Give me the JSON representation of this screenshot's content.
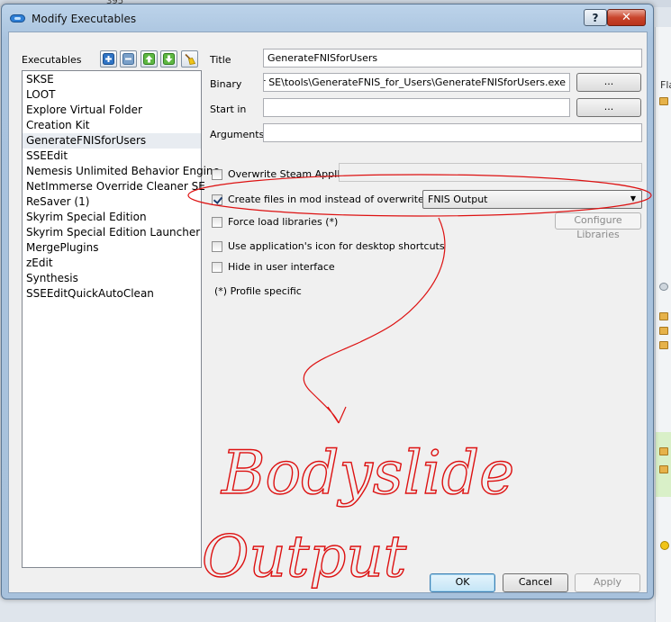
{
  "background": {
    "corner_number": "395",
    "right_label": "Fla"
  },
  "window": {
    "title": "Modify Executables",
    "help_glyph": "?",
    "close_glyph": "✕"
  },
  "executables": {
    "label": "Executables",
    "items": [
      "SKSE",
      "LOOT",
      "Explore Virtual Folder",
      "Creation Kit",
      "GenerateFNISforUsers",
      "SSEEdit",
      "Nemesis Unlimited Behavior Engine",
      "NetImmerse Override Cleaner SE",
      "ReSaver (1)",
      "Skyrim Special Edition",
      "Skyrim Special Edition Launcher",
      "MergePlugins",
      "zEdit",
      "Synthesis",
      "SSEEditQuickAutoClean"
    ],
    "selected": "GenerateFNISforUsers"
  },
  "form": {
    "title_label": "Title",
    "title_value": "GenerateFNISforUsers",
    "binary_label": "Binary",
    "binary_value": "ehavior SE\\tools\\GenerateFNIS_for_Users\\GenerateFNISforUsers.exe",
    "start_in_label": "Start in",
    "start_in_value": "",
    "arguments_label": "Arguments",
    "arguments_value": "",
    "browse_label": "...",
    "overwrite_steam_appid": {
      "label": "Overwrite Steam AppID",
      "checked": false,
      "value": ""
    },
    "create_files_in_mod": {
      "label": "Create files in mod instead of overwrite (*)",
      "checked": true
    },
    "mod_combo_value": "FNIS Output",
    "force_load_libraries": {
      "label": "Force load libraries (*)",
      "checked": false
    },
    "configure_libraries_label": "Configure Libraries",
    "use_app_icon": {
      "label": "Use application's icon for desktop shortcuts",
      "checked": false
    },
    "hide_in_ui": {
      "label": "Hide in user interface",
      "checked": false
    },
    "profile_note": "(*) Profile specific"
  },
  "buttons": {
    "ok": "OK",
    "cancel": "Cancel",
    "apply": "Apply"
  },
  "annotation": {
    "line1": "Bodyslide",
    "line2": "Output",
    "color": "#d11111"
  }
}
